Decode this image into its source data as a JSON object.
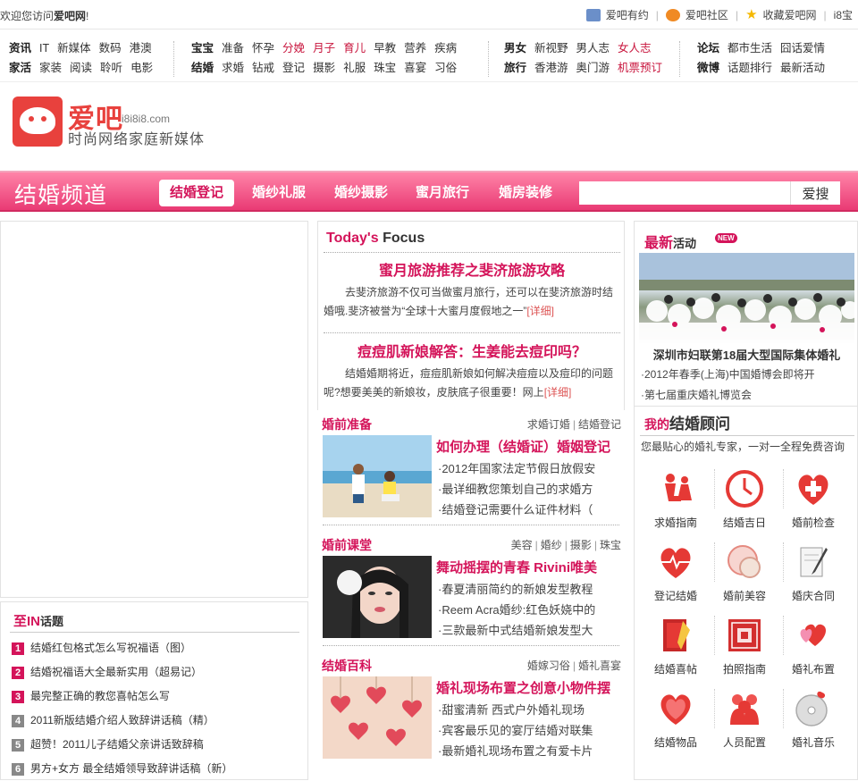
{
  "topbar": {
    "welcome_prefix": "欢迎您访问",
    "welcome_site": "爱吧网",
    "welcome_suffix": "!",
    "links": [
      {
        "label": "爱吧有约",
        "icon": "person-card-icon",
        "color": "#6b8fc9"
      },
      {
        "label": "爱吧社区",
        "icon": "chat-bubble-icon",
        "color": "#f08a24"
      },
      {
        "label": "收藏爱吧网",
        "icon": "star-icon",
        "color": "#f5b800"
      }
    ],
    "last_link": "i8宝"
  },
  "nav": {
    "groups": [
      {
        "rows": [
          [
            {
              "t": "资讯",
              "s": "h"
            },
            {
              "t": "IT"
            },
            {
              "t": "新媒体"
            },
            {
              "t": "数码"
            },
            {
              "t": "港澳"
            }
          ],
          [
            {
              "t": "家活",
              "s": "h"
            },
            {
              "t": "家装"
            },
            {
              "t": "阅读"
            },
            {
              "t": "聆听"
            },
            {
              "t": "电影"
            }
          ]
        ]
      },
      {
        "rows": [
          [
            {
              "t": "宝宝",
              "s": "h"
            },
            {
              "t": "准备"
            },
            {
              "t": "怀孕"
            },
            {
              "t": "分娩",
              "s": "r"
            },
            {
              "t": "月子",
              "s": "r"
            },
            {
              "t": "育儿",
              "s": "r"
            },
            {
              "t": "早教"
            },
            {
              "t": "营养"
            },
            {
              "t": "疾病"
            }
          ],
          [
            {
              "t": "结婚",
              "s": "h"
            },
            {
              "t": "求婚"
            },
            {
              "t": "钻戒"
            },
            {
              "t": "登记"
            },
            {
              "t": "摄影"
            },
            {
              "t": "礼服"
            },
            {
              "t": "珠宝"
            },
            {
              "t": "喜宴"
            },
            {
              "t": "习俗"
            }
          ]
        ]
      },
      {
        "rows": [
          [
            {
              "t": "男女",
              "s": "h"
            },
            {
              "t": "新视野"
            },
            {
              "t": "男人志"
            },
            {
              "t": "女人志",
              "s": "r"
            }
          ],
          [
            {
              "t": "旅行",
              "s": "h"
            },
            {
              "t": "香港游"
            },
            {
              "t": "奥门游"
            },
            {
              "t": "机票预订",
              "s": "r"
            }
          ]
        ]
      },
      {
        "rows": [
          [
            {
              "t": "论坛",
              "s": "h"
            },
            {
              "t": "都市生活"
            },
            {
              "t": "囧话爱情"
            }
          ],
          [
            {
              "t": "微博",
              "s": "h"
            },
            {
              "t": "话题排行"
            },
            {
              "t": "最新活动"
            }
          ]
        ]
      }
    ]
  },
  "logo": {
    "name": "爱吧",
    "domain": "i8i8i8.com",
    "slogan": "时尚网络家庭新媒体",
    "color": "#e8413d"
  },
  "channel": {
    "title": "结婚频道",
    "tabs": [
      "结婚登记",
      "婚纱礼服",
      "婚纱摄影",
      "蜜月旅行",
      "婚房装修"
    ],
    "active_tab": "结婚登记",
    "search_placeholder": "",
    "search_button": "爱搜",
    "accent": "#d4145a"
  },
  "topics": {
    "title_big": "至IN",
    "title_small": "话题",
    "items": [
      {
        "n": "1",
        "text": "结婚红包格式怎么写祝福语（图）",
        "color": "#d4145a"
      },
      {
        "n": "2",
        "text": "结婚祝福语大全最新实用（超易记）",
        "color": "#d4145a"
      },
      {
        "n": "3",
        "text": "最完整正确的教您喜帖怎么写",
        "color": "#d4145a"
      },
      {
        "n": "4",
        "text": "2011新版结婚介绍人致辞讲话稿（精）",
        "color": "#888888"
      },
      {
        "n": "5",
        "text": "超赞！2011儿子结婚父亲讲话致辞稿",
        "color": "#888888"
      },
      {
        "n": "6",
        "text": "男方+女方 最全结婚领导致辞讲话稿（新）",
        "color": "#888888"
      }
    ]
  },
  "focus": {
    "head_red": "Today's",
    "head_dark": "Focus",
    "articles": [
      {
        "title": "蜜月旅游推荐之斐济旅游攻略",
        "body": "去斐济旅游不仅可当做蜜月旅行，还可以在斐济旅游时结婚哦.斐济被誉为“全球十大蜜月度假地之一”",
        "more": "[详细]"
      },
      {
        "title": "痘痘肌新娘解答：生姜能去痘印吗？",
        "body": "结婚婚期将近，痘痘肌新娘如何解决痘痘以及痘印的问题呢?想要美美的新娘妆，皮肤底子很重要！网上",
        "more": "[详细]"
      }
    ]
  },
  "sections": [
    {
      "head": "婚前准备",
      "links": [
        "求婚订婚",
        "结婚登记"
      ],
      "title": "如何办理（结婚证）婚姻登记",
      "items": [
        "·2012年国家法定节假日放假安",
        "·最详细教您策划自己的求婚方",
        "·结婚登记需要什么证件材料（"
      ],
      "pic": "beach-proposal-photo"
    },
    {
      "head": "婚前课堂",
      "links": [
        "美容",
        "婚纱",
        "摄影",
        "珠宝"
      ],
      "title": "舞动摇摆的青春 Rivini唯美",
      "items": [
        "·春夏清丽简约的新娘发型教程",
        "·Reem Acra婚纱:红色妖娆中的",
        "·三款最新中式结婚新娘发型大"
      ],
      "pic": "bride-portrait-photo"
    },
    {
      "head": "结婚百科",
      "links": [
        "婚嫁习俗",
        "婚礼喜宴"
      ],
      "title": "婚礼现场布置之创意小物件摆",
      "items": [
        "·甜蜜清新 西式户外婚礼现场",
        "·宾客最乐见的宴厅结婚对联集",
        "·最新婚礼现场布置之有爱卡片"
      ],
      "pic": "heart-decor-photo"
    }
  ],
  "events": {
    "title_big": "最新",
    "title_small": "活动",
    "badge": "NEW",
    "caption": "深圳市妇联第18届大型国际集体婚礼",
    "items": [
      "·2012年春季(上海)中国婚博会即将开",
      "·第七届重庆婚礼博览会"
    ]
  },
  "advisor": {
    "title_small": "我的",
    "title_big": "结婚顾问",
    "subtitle": "您最贴心的婚礼专家，一对一全程免费咨询",
    "items": [
      {
        "label": "求婚指南",
        "icon": "kneeling-proposal-icon"
      },
      {
        "label": "结婚吉日",
        "icon": "clock-icon"
      },
      {
        "label": "婚前检查",
        "icon": "medical-cross-icon"
      },
      {
        "label": "登记结婚",
        "icon": "heart-pulse-icon"
      },
      {
        "label": "婚前美容",
        "icon": "compact-mirror-icon"
      },
      {
        "label": "婚庆合同",
        "icon": "document-pen-icon"
      },
      {
        "label": "结婚喜帖",
        "icon": "invitation-card-icon"
      },
      {
        "label": "拍照指南",
        "icon": "double-happiness-icon"
      },
      {
        "label": "婚礼布置",
        "icon": "heart-balloon-icon"
      },
      {
        "label": "结婚物品",
        "icon": "heart-box-icon"
      },
      {
        "label": "人员配置",
        "icon": "people-group-icon"
      },
      {
        "label": "婚礼音乐",
        "icon": "music-disc-icon"
      }
    ]
  }
}
